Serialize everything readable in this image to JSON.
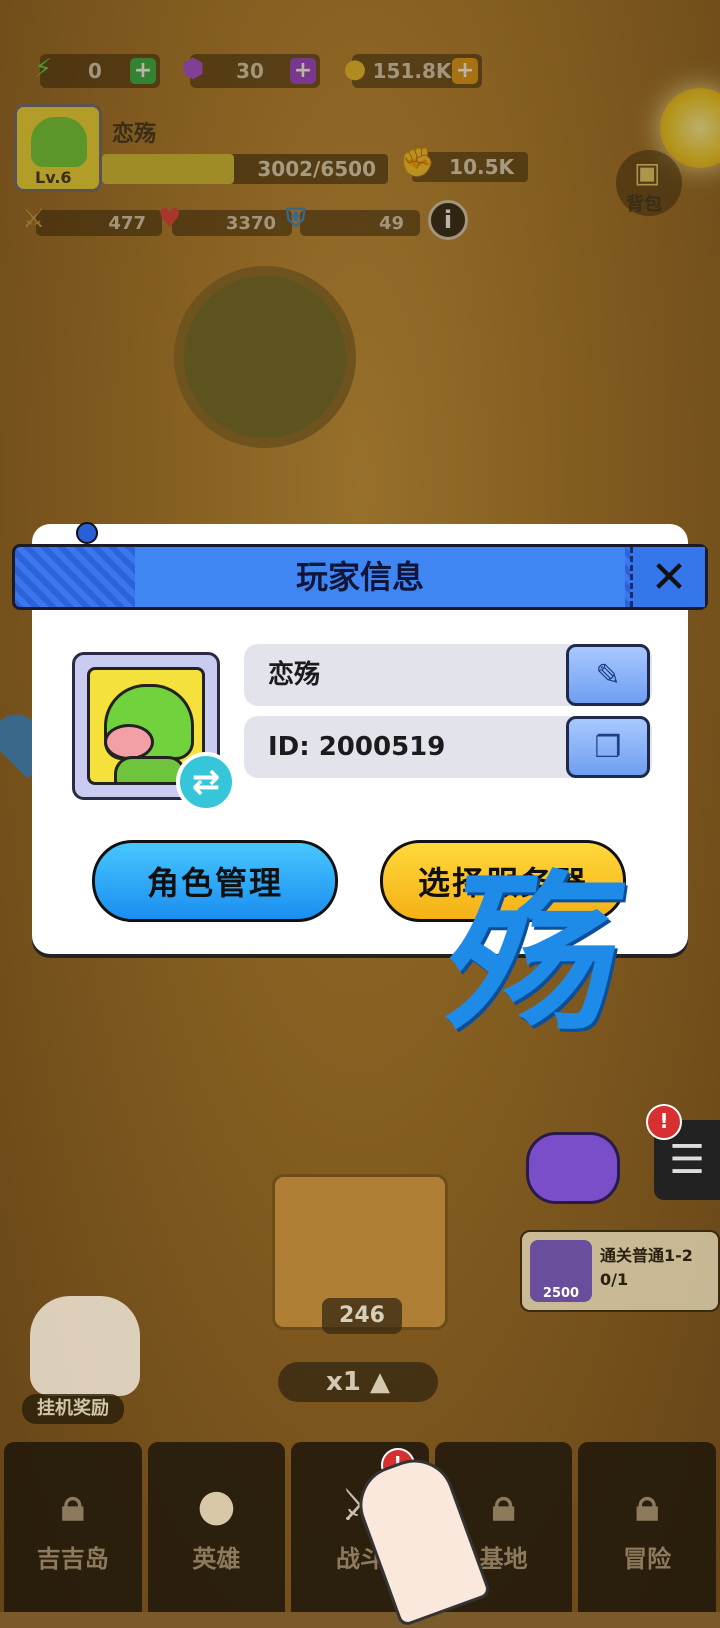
{
  "hud": {
    "energy": "0",
    "gems": "30",
    "gold": "151.8K",
    "player_name": "恋殇",
    "level": "Lv.6",
    "xp": "3002/6500",
    "xp_fraction": 0.462,
    "power": "10.5K",
    "attack": "477",
    "hp": "3370",
    "defense": "49",
    "backpack_label": "背包"
  },
  "modal": {
    "title": "玩家信息",
    "name_value": "恋殇",
    "id_value": "ID: 2000519",
    "role_button": "角色管理",
    "server_button": "选择服务器"
  },
  "overlay_char": "殇",
  "quest": {
    "title": "通关普通1-2",
    "progress": "0/1",
    "reward": "2500"
  },
  "crate_count": "246",
  "speed": "x1 ▲",
  "idle_reward_label": "挂机奖励",
  "nav": [
    {
      "label": "吉吉岛",
      "icon": "lock-icon"
    },
    {
      "label": "英雄",
      "icon": "pig-hero-icon"
    },
    {
      "label": "战斗",
      "icon": "swords-icon"
    },
    {
      "label": "基地",
      "icon": "lock-icon"
    },
    {
      "label": "冒险",
      "icon": "lock-icon"
    }
  ],
  "colors": {
    "modal_header": "#3f86f3",
    "role_button": "#1b8ef0",
    "server_button": "#f4b116",
    "overlay_char": "#1f8be8"
  }
}
